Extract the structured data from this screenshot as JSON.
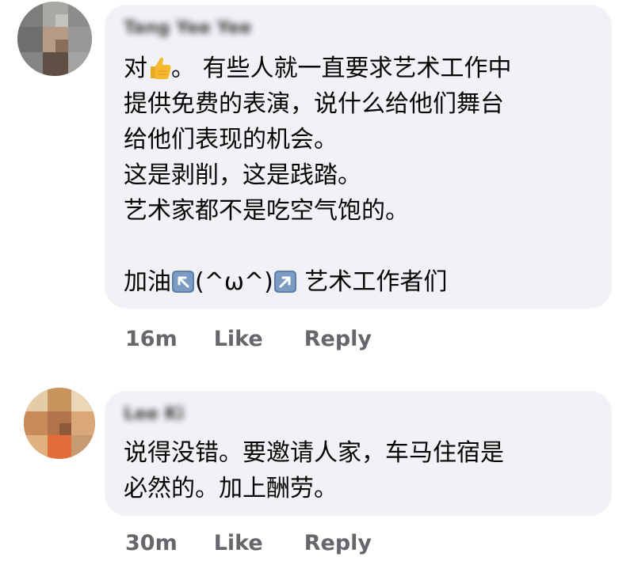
{
  "comments": [
    {
      "author": "Tang Yee Yee",
      "avatar_icon": "user-avatar-icon",
      "text_before_emoji": "对",
      "emoji": "thumbs-up-icon",
      "text_after_emoji": "。 有些人就一直要求艺术工作中",
      "lines": [
        "提供免费的表演，说什么给他们舞台",
        "给他们表现的机会。",
        "这是剥削，这是践踏。",
        "艺术家都不是吃空气饱的。"
      ],
      "sign_prefix": "加油",
      "sign_face": "(^ω^)",
      "sign_suffix": " 艺术工作者们",
      "arrow_left_icon": "arrow-up-left-icon",
      "arrow_right_icon": "arrow-up-right-icon",
      "time": "16m",
      "like_label": "Like",
      "reply_label": "Reply"
    },
    {
      "author": "Lee Ki",
      "avatar_icon": "user-avatar-icon",
      "lines": [
        "说得没错。要邀请人家，车马住宿是",
        "必然的。加上酬劳。"
      ],
      "time": "30m",
      "like_label": "Like",
      "reply_label": "Reply"
    }
  ],
  "colors": {
    "bubble_bg": "#f0f2f5",
    "meta_text": "#65676b",
    "body_text": "#050505",
    "emoji_yellow": "#f5b82e",
    "keycap_blue": "#5f7fa8"
  }
}
